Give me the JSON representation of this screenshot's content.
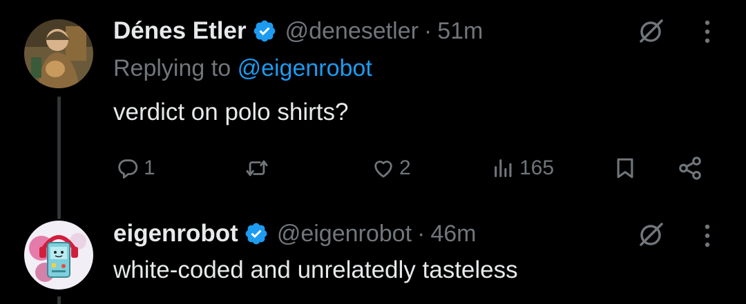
{
  "colors": {
    "background": "#000000",
    "text_primary": "#e7e9ea",
    "text_secondary": "#71767b",
    "link": "#1d9bf0",
    "verified": "#1d9bf0",
    "thread_line": "#333639"
  },
  "tweets": [
    {
      "display_name": "Dénes Etler",
      "handle": "@denesetler",
      "separator": "·",
      "time": "51m",
      "replying_label": "Replying to",
      "replying_to": "@eigenrobot",
      "text": "verdict on polo shirts?",
      "avatar_icon": "avatar-monk-painting",
      "actions": {
        "reply_count": "1",
        "retweet_count": "",
        "like_count": "2",
        "views_count": "165"
      }
    },
    {
      "display_name": "eigenrobot",
      "handle": "@eigenrobot",
      "separator": "·",
      "time": "46m",
      "text": "white-coded and unrelatedly tasteless",
      "avatar_icon": "avatar-robot-headphones"
    }
  ],
  "icons": {
    "verified": "verified-badge-icon",
    "grok": "grok-icon",
    "more": "more-vertical-icon",
    "reply": "reply-icon",
    "retweet": "retweet-icon",
    "like": "heart-icon",
    "views": "views-icon",
    "bookmark": "bookmark-icon",
    "share": "share-icon"
  }
}
